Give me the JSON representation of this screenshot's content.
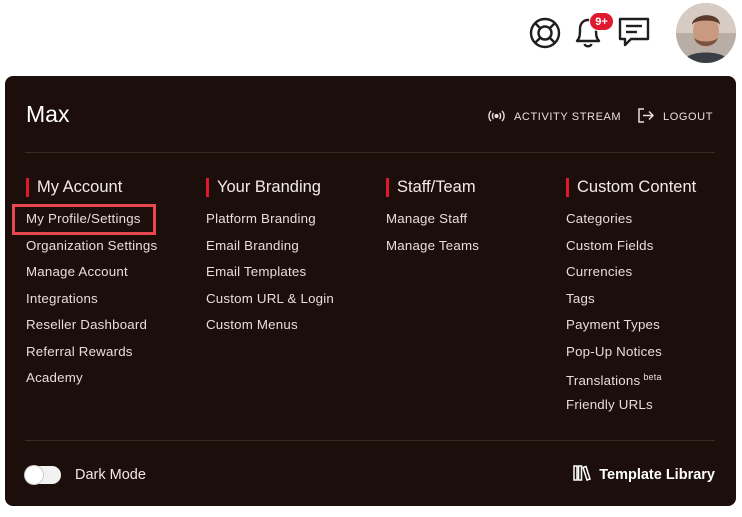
{
  "header": {
    "notification_badge": "9+",
    "icons": [
      "help-icon",
      "bell-icon",
      "chat-icon"
    ]
  },
  "menu": {
    "user_name": "Max",
    "activity_stream_label": "ACTIVITY STREAM",
    "logout_label": "LOGOUT",
    "columns": [
      {
        "title": "My Account",
        "items": [
          "My Profile/Settings",
          "Organization Settings",
          "Manage Account",
          "Integrations",
          "Reseller Dashboard",
          "Referral Rewards",
          "Academy"
        ]
      },
      {
        "title": "Your Branding",
        "items": [
          "Platform Branding",
          "Email Branding",
          "Email Templates",
          "Custom URL & Login",
          "Custom Menus"
        ]
      },
      {
        "title": "Staff/Team",
        "items": [
          "Manage Staff",
          "Manage Teams"
        ]
      },
      {
        "title": "Custom Content",
        "items": [
          "Categories",
          "Custom Fields",
          "Currencies",
          "Tags",
          "Payment Types",
          "Pop-Up Notices",
          "Translations",
          "Friendly URLs"
        ],
        "translations_tag": "beta"
      }
    ],
    "dark_mode_label": "Dark Mode",
    "template_library_label": "Template Library"
  },
  "colors": {
    "panel_bg": "#1c0f0b",
    "accent": "#e0192e",
    "highlight_box": "#e8474f"
  }
}
